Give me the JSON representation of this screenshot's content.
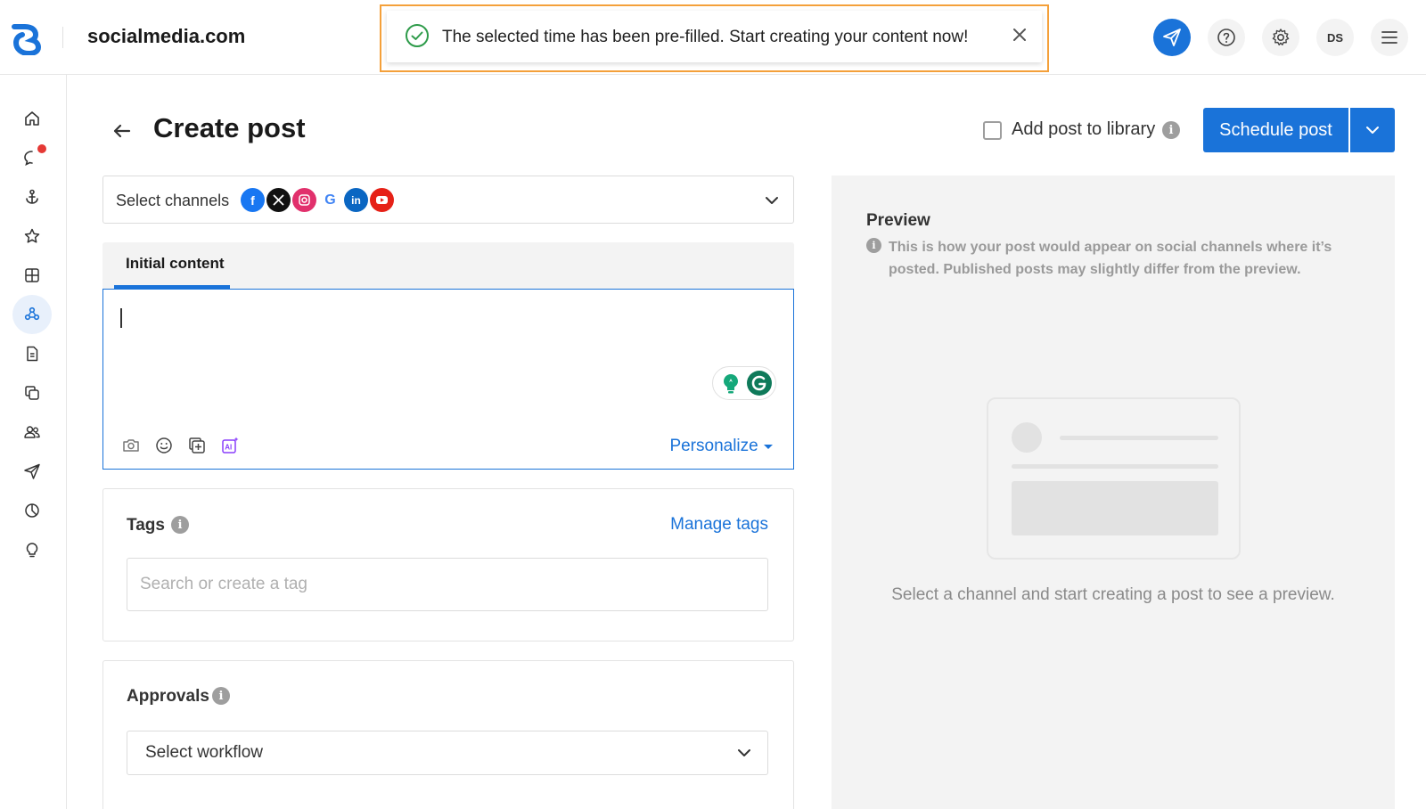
{
  "header": {
    "site_title": "socialmedia.com",
    "avatar_initials": "DS"
  },
  "toast": {
    "message": "The selected time has been pre-filled. Start creating your content now!"
  },
  "page": {
    "title": "Create post",
    "add_to_library_label": "Add post to library",
    "schedule_button": "Schedule post"
  },
  "channels": {
    "label": "Select channels",
    "icons": [
      "facebook-icon",
      "x-icon",
      "instagram-icon",
      "google-icon",
      "linkedin-icon",
      "youtube-icon"
    ]
  },
  "editor": {
    "tab_label": "Initial content",
    "personalize_label": "Personalize",
    "text": ""
  },
  "tags": {
    "title": "Tags",
    "manage_label": "Manage tags",
    "placeholder": "Search or create a tag"
  },
  "approvals": {
    "title": "Approvals",
    "workflow_value": "Select workflow"
  },
  "preview": {
    "title": "Preview",
    "note": "This is how your post would appear on social channels where it’s posted. Published posts may slightly differ from the preview.",
    "empty_message": "Select a channel and start creating a post to see a preview."
  },
  "colors": {
    "accent": "#1a73d9",
    "toast_highlight": "#f4a03a",
    "success": "#2e9b4a",
    "notification": "#e53935"
  }
}
